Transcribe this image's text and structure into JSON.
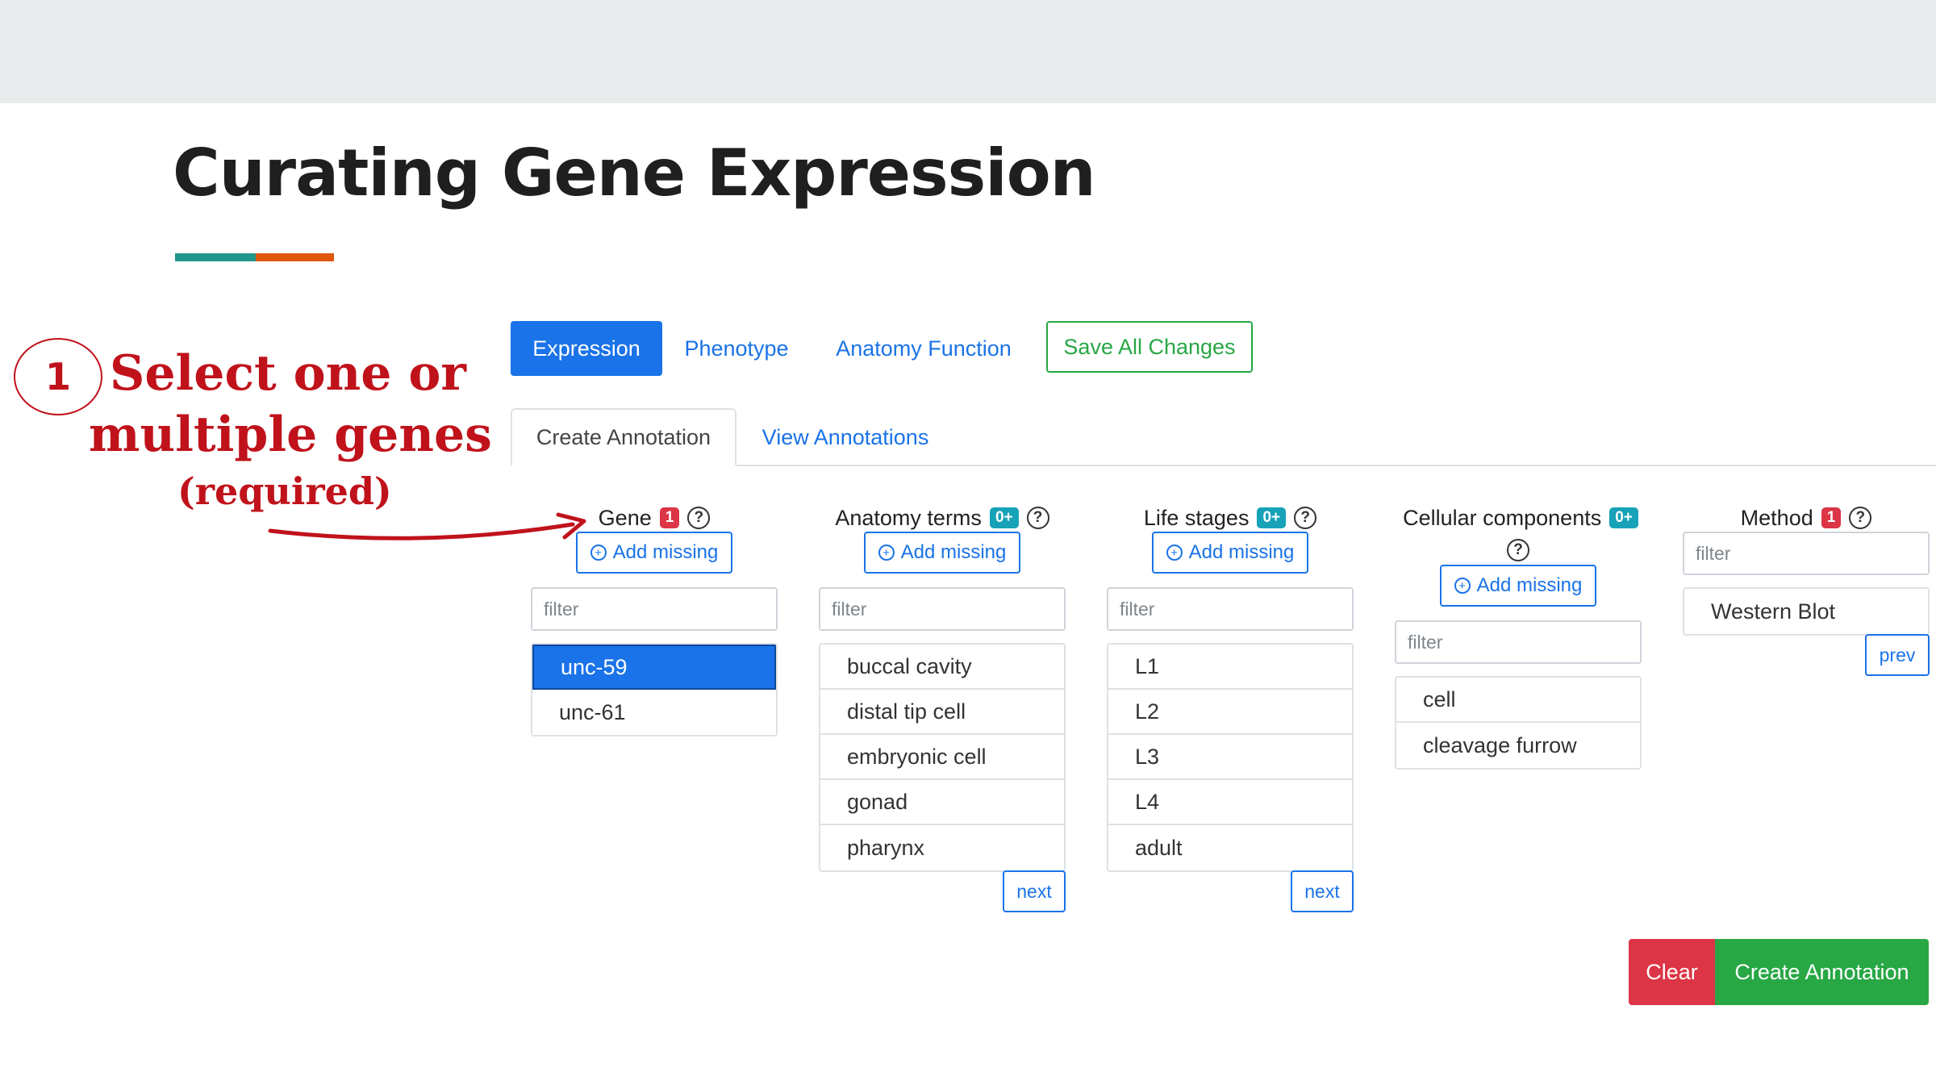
{
  "slide": {
    "title": "Curating Gene Expression",
    "accent_colors": [
      "#1f9689",
      "#e0570f"
    ]
  },
  "callout": {
    "step": "1",
    "line1": "Select one or",
    "line2": "multiple genes",
    "line3": "(required)",
    "color": "#c0121b"
  },
  "nav": {
    "tabs": [
      "Expression",
      "Phenotype",
      "Anatomy Function"
    ],
    "active_tab": "Expression",
    "save_label": "Save All Changes"
  },
  "subtabs": [
    "Create Annotation",
    "View Annotations"
  ],
  "columns": {
    "gene": {
      "label": "Gene",
      "badge": "1",
      "help": "?",
      "add_missing": "Add missing",
      "filter_placeholder": "filter",
      "items": [
        "unc-59",
        "unc-61"
      ],
      "selected": "unc-59"
    },
    "anatomy": {
      "label": "Anatomy terms",
      "badge": "0+",
      "help": "?",
      "add_missing": "Add missing",
      "filter_placeholder": "filter",
      "items": [
        "buccal cavity",
        "distal tip cell",
        "embryonic cell",
        "gonad",
        "pharynx"
      ],
      "pager": "next"
    },
    "life_stages": {
      "label": "Life stages",
      "badge": "0+",
      "help": "?",
      "add_missing": "Add missing",
      "filter_placeholder": "filter",
      "items": [
        "L1",
        "L2",
        "L3",
        "L4",
        "adult"
      ],
      "pager": "next"
    },
    "cellular": {
      "label": "Cellular components",
      "badge": "0+",
      "help": "?",
      "add_missing": "Add missing",
      "filter_placeholder": "filter",
      "items": [
        "cell",
        "cleavage furrow"
      ]
    },
    "method": {
      "label": "Method",
      "badge": "1",
      "help": "?",
      "filter_placeholder": "filter",
      "items": [
        "Western Blot"
      ],
      "pager": "prev"
    }
  },
  "actions": {
    "clear": "Clear",
    "create": "Create Annotation"
  },
  "colors": {
    "primary": "#1a73e8",
    "success": "#28a745",
    "danger": "#dc3545",
    "info": "#17a2b8"
  },
  "icons": {
    "help": "question-circle-icon",
    "add": "plus-circle-icon"
  }
}
